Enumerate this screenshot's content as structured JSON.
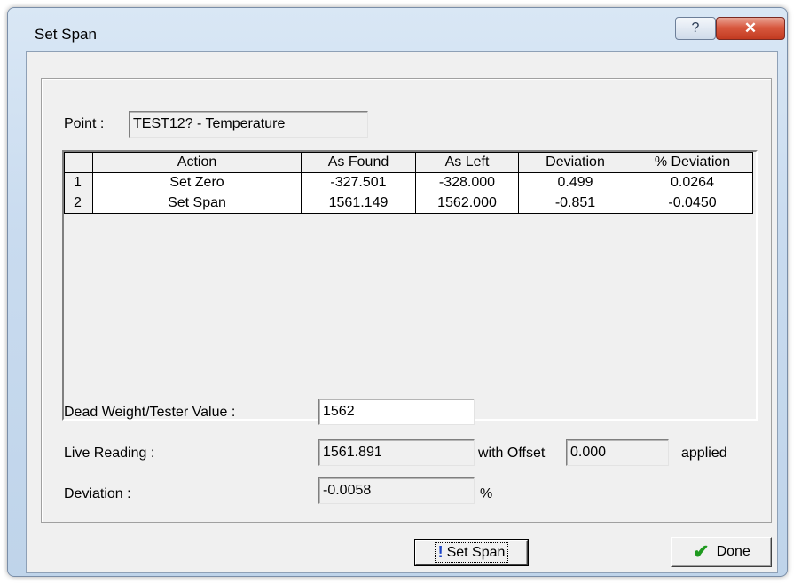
{
  "window": {
    "title": "Set Span",
    "help_icon": "question-icon",
    "close_icon": "close-icon"
  },
  "point": {
    "label": "Point :",
    "value": "TEST12? - Temperature"
  },
  "table": {
    "columns": [
      "Action",
      "As Found",
      "As Left",
      "Deviation",
      "% Deviation"
    ],
    "rows": [
      {
        "num": "1",
        "action": "Set Zero",
        "as_found": "-327.501",
        "as_left": "-328.000",
        "deviation": "0.499",
        "pct_deviation": "0.0264"
      },
      {
        "num": "2",
        "action": "Set Span",
        "as_found": "1561.149",
        "as_left": "1562.000",
        "deviation": "-0.851",
        "pct_deviation": "-0.0450"
      }
    ]
  },
  "dead_weight": {
    "label": "Dead Weight/Tester Value :",
    "value": "1562"
  },
  "live_reading": {
    "label": "Live Reading :",
    "value": "1561.891",
    "offset_label": "with Offset",
    "offset_value": "0.000",
    "applied_label": "applied"
  },
  "deviation": {
    "label": "Deviation :",
    "value": "-0.0058",
    "unit": "%"
  },
  "buttons": {
    "set_span": "Set Span",
    "done": "Done"
  },
  "colors": {
    "accent_check": "#1f9a1f",
    "close_red": "#c23a20"
  }
}
